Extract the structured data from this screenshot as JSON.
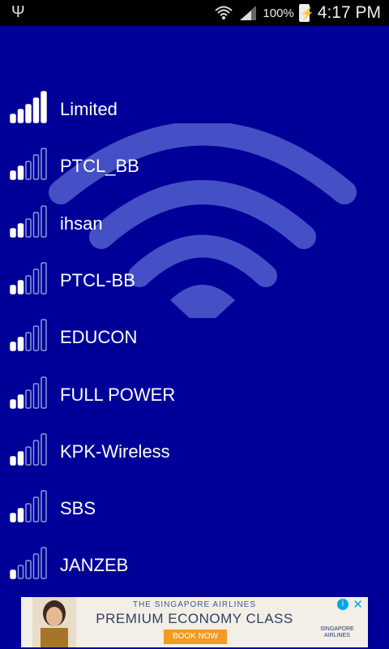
{
  "status_bar": {
    "usb_icon": "usb-icon",
    "battery_percent": "100%",
    "time": "4:17 PM"
  },
  "networks": [
    {
      "name": "Limited",
      "signal_bars": 4
    },
    {
      "name": "PTCL_BB",
      "signal_bars": 1
    },
    {
      "name": "ihsan",
      "signal_bars": 1
    },
    {
      "name": "PTCL-BB",
      "signal_bars": 1
    },
    {
      "name": "EDUCON",
      "signal_bars": 1
    },
    {
      "name": "FULL POWER",
      "signal_bars": 1
    },
    {
      "name": "KPK-Wireless",
      "signal_bars": 1
    },
    {
      "name": "SBS",
      "signal_bars": 1
    },
    {
      "name": "JANZEB",
      "signal_bars": 0
    }
  ],
  "ad": {
    "line1": "THE SINGAPORE AIRLINES",
    "line2": "PREMIUM ECONOMY CLASS",
    "button": "BOOK NOW",
    "brand": "SINGAPORE AIRLINES"
  },
  "colors": {
    "background": "#000099",
    "bar_filled": "#ffffff",
    "bar_outline": "#8a9ad8",
    "watermark": "#5c6bd6"
  }
}
